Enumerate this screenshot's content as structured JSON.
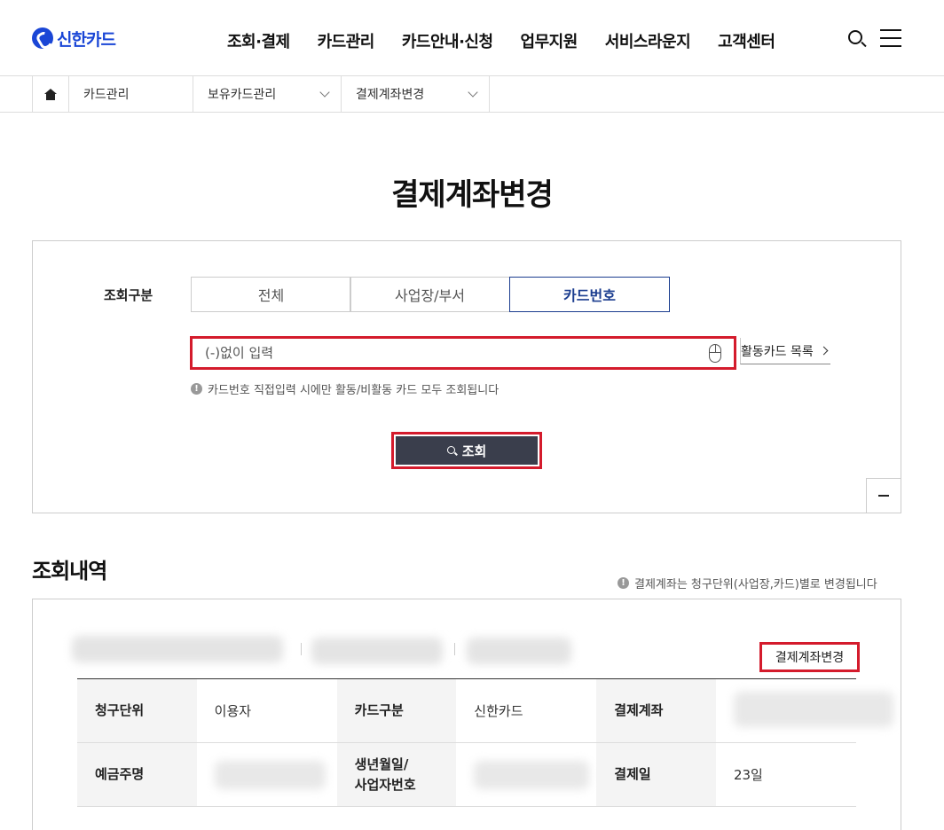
{
  "header": {
    "logo_text": "신한카드",
    "menu": [
      "조회·결제",
      "카드관리",
      "카드안내·신청",
      "업무지원",
      "서비스라운지",
      "고객센터"
    ]
  },
  "breadcrumb": {
    "items": [
      "카드관리",
      "보유카드관리",
      "결제계좌변경"
    ]
  },
  "page": {
    "title": "결제계좌변경"
  },
  "search": {
    "type_label": "조회구분",
    "segments": [
      "전체",
      "사업장/부서",
      "카드번호"
    ],
    "selected_segment": "카드번호",
    "card_placeholder": "(-)없이 입력",
    "active_card_link": "활동카드 목록",
    "notice": "카드번호 직접입력 시에만 활동/비활동 카드 모두 조회됩니다",
    "submit_label": "조회"
  },
  "results": {
    "title": "조회내역",
    "notice": "결제계좌는 청구단위(사업장,카드)별로 변경됩니다",
    "change_button": "결제계좌변경",
    "rows": [
      [
        {
          "label": "청구단위",
          "value": "이용자"
        },
        {
          "label": "카드구분",
          "value": "신한카드"
        },
        {
          "label": "결제계좌",
          "value": ""
        }
      ],
      [
        {
          "label": "예금주명",
          "value": ""
        },
        {
          "label": "생년월일/\n사업자번호",
          "value": ""
        },
        {
          "label": "결제일",
          "value": "23일"
        }
      ]
    ]
  },
  "colors": {
    "brand": "#1a46d6",
    "accent_navy": "#1b3d8f",
    "highlight_red": "#d41b2c",
    "button_dark": "#3a3e4c"
  }
}
